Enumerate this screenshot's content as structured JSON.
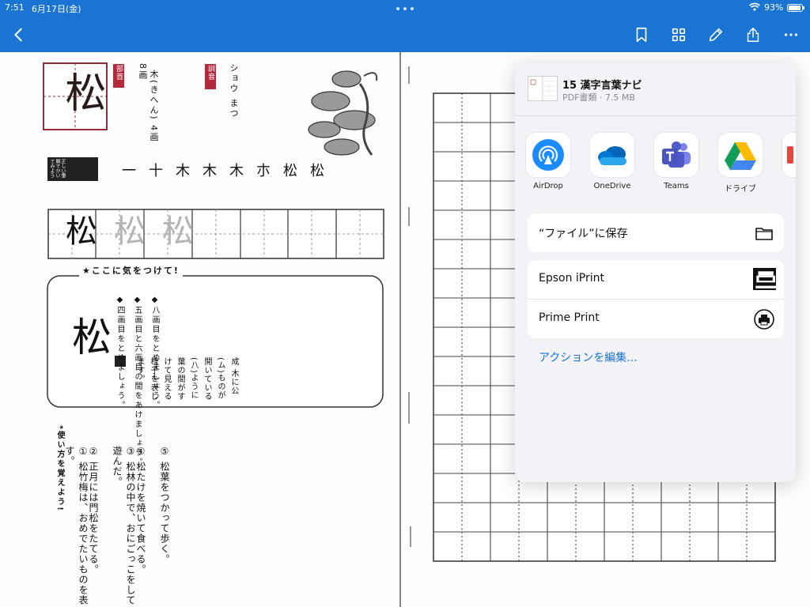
{
  "status": {
    "time": "7:51",
    "date": "6月17日(金)",
    "battery": "93%",
    "battery_level": 0.93
  },
  "toolbar": {
    "icons": [
      "back-icon",
      "bookmark-icon",
      "grid-icon",
      "pencil-icon",
      "share-icon",
      "more-icon"
    ],
    "accent": "#1a74d4"
  },
  "document": {
    "kanji": "松",
    "radical_label": "部首",
    "strokes_label": "総画",
    "strokes": "8画",
    "radical": "木(きへん) 4画",
    "reading_label": "訓音",
    "readings": "ショウ まつ",
    "stroke_order_label": "正しい筆順でかいてみよう",
    "stroke_steps": [
      "一",
      "十",
      "木",
      "木",
      "木",
      "朩",
      "松",
      "松"
    ],
    "attention_title": "★ここに気をつけて!",
    "attention_notes": [
      "◆四画目をとめましょう。",
      "◆五画目と六画目の間をあけましょう。",
      "◆八画目をとめましょう。"
    ],
    "origin_note": "成 木に公(ム)ものが開いている(八)ように葉の間がすけて見える様子を表します。",
    "usage_title": "*使い方を覚えよう!",
    "usage_examples": [
      "① 松竹梅は、おめでたいものを表す。",
      "② 正月には門松をたてる。",
      "③ 松林の中で、おにごっこをして遊んだ。",
      "④ 松たけを焼いて食べる。",
      "⑤ 松葉をつかって歩く。"
    ]
  },
  "share_sheet": {
    "file_name": "15 漢字言葉ナビ",
    "file_meta": "PDF書類 · 7.5 MB",
    "apps": [
      {
        "label": "AirDrop",
        "icon": "airdrop-icon"
      },
      {
        "label": "OneDrive",
        "icon": "onedrive-icon"
      },
      {
        "label": "Teams",
        "icon": "teams-icon"
      },
      {
        "label": "ドライブ",
        "icon": "google-drive-icon"
      }
    ],
    "save_files": "“ファイル”に保存",
    "actions": [
      "Epson iPrint",
      "Prime Print"
    ],
    "edit_actions": "アクションを編集..."
  }
}
